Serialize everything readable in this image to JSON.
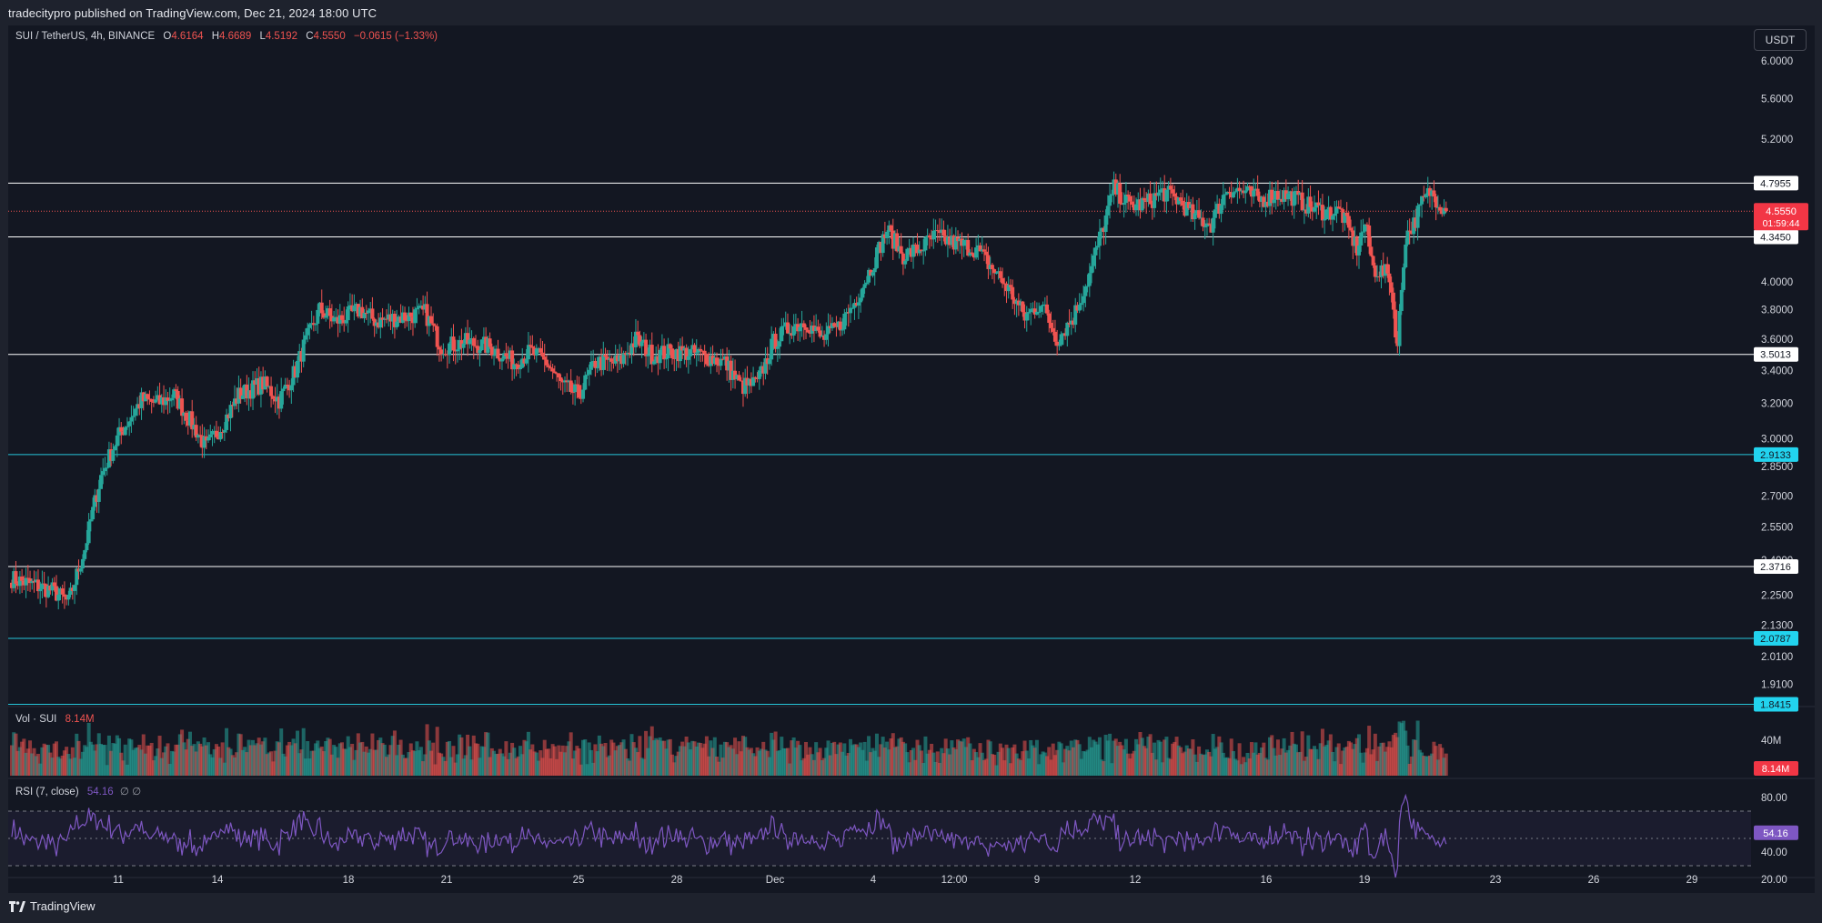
{
  "header": {
    "publisher": "tradecitypro published on TradingView.com, Dec 21, 2024 18:00 UTC"
  },
  "footer": {
    "brand": "TradingView"
  },
  "currency_button": "USDT",
  "legend": {
    "symbol": "SUI / TetherUS, 4h, BINANCE",
    "open_label": "O",
    "open": "4.6164",
    "high_label": "H",
    "high": "4.6689",
    "low_label": "L",
    "low": "4.5192",
    "close_label": "C",
    "close": "4.5550",
    "change": "−0.0615 (−1.33%)",
    "volume_label": "Vol · SUI",
    "volume_value": "8.14M",
    "rsi_label": "RSI (7, close)",
    "rsi_value": "54.16",
    "rsi_extra": "∅ ∅"
  },
  "colors": {
    "up": "#26a69a",
    "down": "#ef5350",
    "rsi": "#7e57c2",
    "level_white": "#ffffff",
    "level_cyan": "#26c6da"
  },
  "chart_data": {
    "type": "candlestick",
    "symbol": "SUI/USDT",
    "timeframe": "4h",
    "exchange": "BINANCE",
    "price_axis": {
      "scale": "log",
      "ticks": [
        "6.0000",
        "5.6000",
        "5.2000",
        "4.0000",
        "3.8000",
        "3.6000",
        "3.4000",
        "3.2000",
        "3.0000",
        "2.8500",
        "2.7000",
        "2.5500",
        "2.4000",
        "2.2500",
        "2.1300",
        "2.0100",
        "1.9100"
      ],
      "range": [
        1.84,
        6.3
      ]
    },
    "time_axis": {
      "ticks": [
        "11",
        "14",
        "18",
        "21",
        "25",
        "28",
        "Dec",
        "4",
        "12:00",
        "9",
        "12",
        "16",
        "19",
        "23",
        "26",
        "29"
      ]
    },
    "levels": [
      {
        "price": 4.7955,
        "label": "4.7955",
        "color": "white"
      },
      {
        "price": 4.345,
        "label": "4.3450",
        "color": "white"
      },
      {
        "price": 3.5013,
        "label": "3.5013",
        "color": "white"
      },
      {
        "price": 2.9133,
        "label": "2.9133",
        "color": "cyan"
      },
      {
        "price": 2.3716,
        "label": "2.3716",
        "color": "white"
      },
      {
        "price": 2.0787,
        "label": "2.0787",
        "color": "cyan"
      },
      {
        "price": 1.8415,
        "label": "1.8415",
        "color": "cyan"
      }
    ],
    "last_price": {
      "value": 4.555,
      "label": "4.5550",
      "countdown": "01:59:44"
    },
    "price_path": [
      [
        0,
        2.32
      ],
      [
        5,
        2.27
      ],
      [
        7,
        2.22
      ],
      [
        9,
        2.45
      ],
      [
        11,
        2.8
      ],
      [
        13,
        3.0
      ],
      [
        16,
        3.22
      ],
      [
        18,
        3.2
      ],
      [
        20,
        3.25
      ],
      [
        22,
        3.1
      ],
      [
        24,
        2.95
      ],
      [
        26,
        3.08
      ],
      [
        28,
        3.25
      ],
      [
        31,
        3.32
      ],
      [
        33,
        3.22
      ],
      [
        35,
        3.4
      ],
      [
        36,
        3.55
      ],
      [
        38,
        3.8
      ],
      [
        40,
        3.72
      ],
      [
        43,
        3.8
      ],
      [
        45,
        3.72
      ],
      [
        48,
        3.75
      ],
      [
        51,
        3.78
      ],
      [
        53,
        3.55
      ],
      [
        56,
        3.58
      ],
      [
        59,
        3.55
      ],
      [
        62,
        3.45
      ],
      [
        64,
        3.52
      ],
      [
        66,
        3.45
      ],
      [
        68,
        3.3
      ],
      [
        70,
        3.25
      ],
      [
        72,
        3.45
      ],
      [
        75,
        3.45
      ],
      [
        77,
        3.6
      ],
      [
        79,
        3.5
      ],
      [
        82,
        3.52
      ],
      [
        85,
        3.5
      ],
      [
        88,
        3.45
      ],
      [
        90,
        3.3
      ],
      [
        92,
        3.32
      ],
      [
        94,
        3.58
      ],
      [
        96,
        3.68
      ],
      [
        98,
        3.72
      ],
      [
        100,
        3.6
      ],
      [
        102,
        3.68
      ],
      [
        104,
        3.85
      ],
      [
        106,
        4.1
      ],
      [
        108,
        4.4
      ],
      [
        110,
        4.2
      ],
      [
        112,
        4.25
      ],
      [
        114,
        4.35
      ],
      [
        116,
        4.3
      ],
      [
        119,
        4.25
      ],
      [
        121,
        4.1
      ],
      [
        123,
        3.95
      ],
      [
        125,
        3.75
      ],
      [
        127,
        3.85
      ],
      [
        129,
        3.6
      ],
      [
        131,
        3.75
      ],
      [
        133,
        4.05
      ],
      [
        135,
        4.5
      ],
      [
        136,
        4.75
      ],
      [
        138,
        4.6
      ],
      [
        140,
        4.62
      ],
      [
        142,
        4.72
      ],
      [
        144,
        4.65
      ],
      [
        146,
        4.5
      ],
      [
        148,
        4.45
      ],
      [
        150,
        4.75
      ],
      [
        152,
        4.72
      ],
      [
        154,
        4.65
      ],
      [
        156,
        4.7
      ],
      [
        158,
        4.68
      ],
      [
        160,
        4.6
      ],
      [
        162,
        4.55
      ],
      [
        164,
        4.55
      ],
      [
        166,
        4.25
      ],
      [
        167,
        4.45
      ],
      [
        168,
        4.1
      ],
      [
        170,
        4.05
      ],
      [
        171,
        3.55
      ],
      [
        172,
        4.35
      ],
      [
        173,
        4.45
      ],
      [
        174,
        4.62
      ],
      [
        175,
        4.72
      ],
      [
        176,
        4.65
      ],
      [
        177,
        4.555
      ]
    ],
    "volume": {
      "axis_ticks": [
        "40M"
      ],
      "last": "8.14M"
    },
    "rsi": {
      "period": 7,
      "axis_ticks": [
        "80.00",
        "40.00",
        "20.00"
      ],
      "band": [
        30,
        70
      ],
      "last": 54.16
    }
  }
}
